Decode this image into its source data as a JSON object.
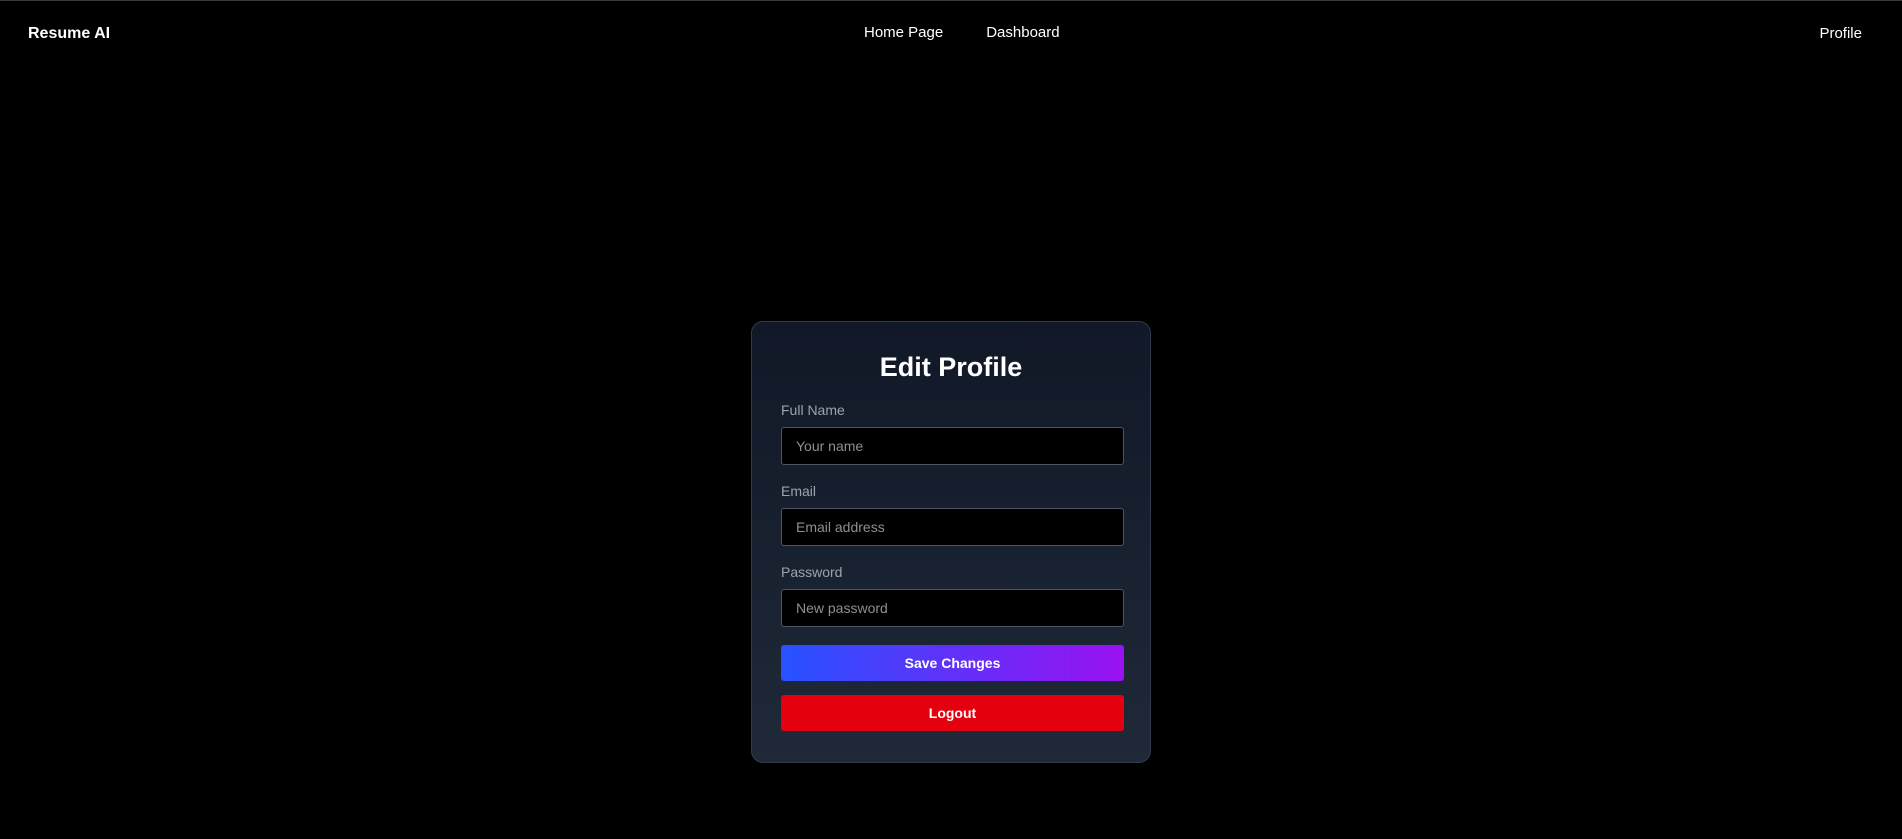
{
  "navbar": {
    "brand": "Resume AI",
    "links": [
      {
        "label": "Home Page"
      },
      {
        "label": "Dashboard"
      }
    ],
    "profile_label": "Profile"
  },
  "card": {
    "title": "Edit Profile",
    "fields": [
      {
        "label": "Full Name",
        "placeholder": "Your name",
        "value": ""
      },
      {
        "label": "Email",
        "placeholder": "Email address",
        "value": ""
      },
      {
        "label": "Password",
        "placeholder": "New password",
        "value": ""
      }
    ],
    "save_label": "Save Changes",
    "logout_label": "Logout"
  },
  "colors": {
    "background": "#000000",
    "card_background": "#111827",
    "save_gradient_start": "#2752ff",
    "save_gradient_end": "#9a11f2",
    "logout": "#e5000f",
    "label": "#9ca3af"
  }
}
